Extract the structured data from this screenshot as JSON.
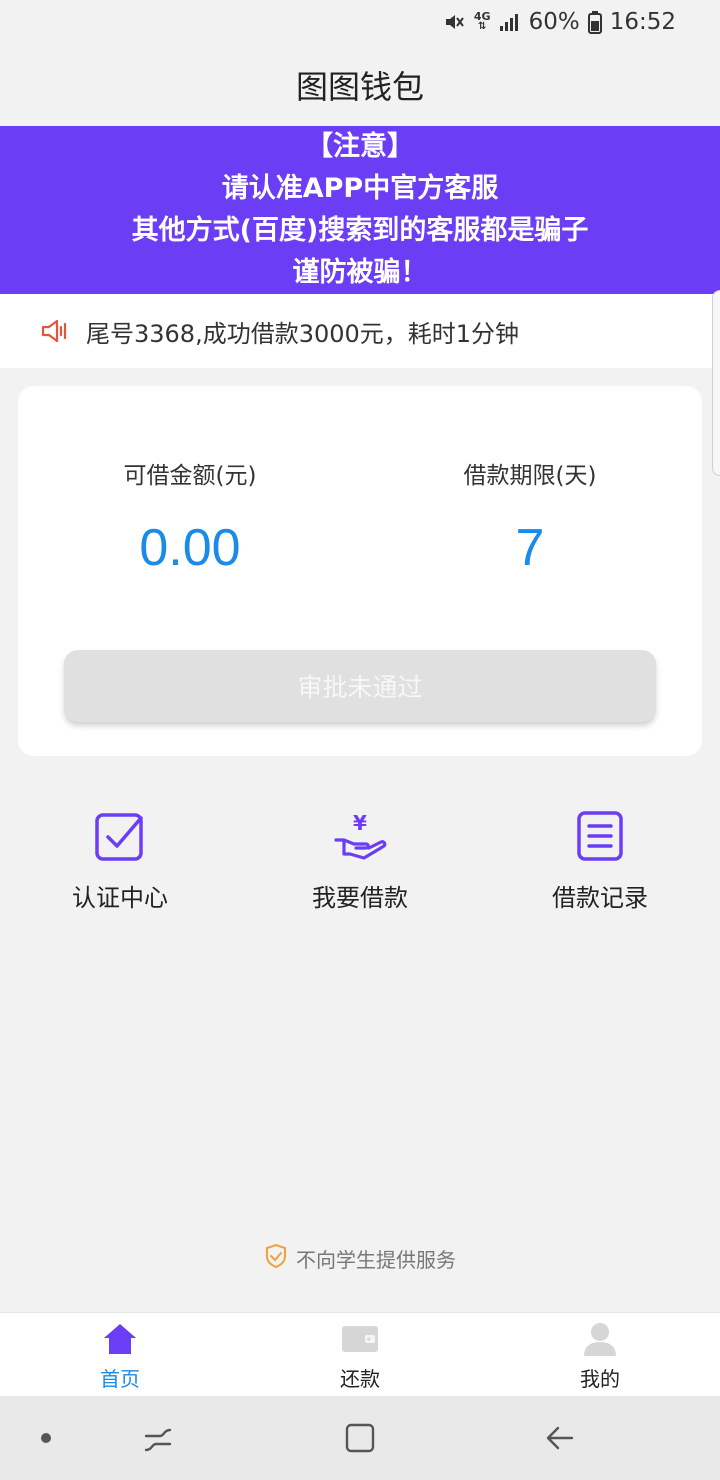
{
  "status_bar": {
    "network": "4G",
    "battery": "60%",
    "time": "16:52"
  },
  "app": {
    "title": "图图钱包"
  },
  "notice": {
    "lines": [
      "【注意】",
      "请认准APP中官方客服",
      "其他方式(百度)搜索到的客服都是骗子",
      "谨防被骗！"
    ]
  },
  "marquee": {
    "text": "尾号3368,成功借款3000元，耗时1分钟"
  },
  "loan": {
    "amount_label": "可借金额(元)",
    "amount_value": "0.00",
    "term_label": "借款期限(天)",
    "term_value": "7",
    "action_label": "审批未通过"
  },
  "features": [
    {
      "label": "认证中心",
      "icon": "checkbox-icon"
    },
    {
      "label": "我要借款",
      "icon": "yuan-hand-icon"
    },
    {
      "label": "借款记录",
      "icon": "list-doc-icon"
    }
  ],
  "footer": {
    "note": "不向学生提供服务"
  },
  "bottom_nav": [
    {
      "label": "首页",
      "icon": "home-icon",
      "active": true
    },
    {
      "label": "还款",
      "icon": "wallet-icon",
      "active": false
    },
    {
      "label": "我的",
      "icon": "user-icon",
      "active": false
    }
  ],
  "colors": {
    "accent_purple": "#6b3df5",
    "value_blue": "#1a8be8",
    "speaker_red": "#e8533f",
    "shield_orange": "#f0a23a"
  }
}
